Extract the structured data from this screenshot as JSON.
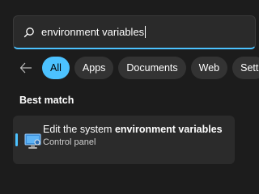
{
  "search": {
    "query": "environment variables",
    "icon": "search-icon"
  },
  "filters": {
    "back_icon": "arrow-left-icon",
    "chips": [
      {
        "label": "All",
        "active": true
      },
      {
        "label": "Apps",
        "active": false
      },
      {
        "label": "Documents",
        "active": false
      },
      {
        "label": "Web",
        "active": false
      },
      {
        "label": "Sett",
        "active": false
      }
    ]
  },
  "best_match": {
    "title": "Best match",
    "result": {
      "title_prefix": "Edit the system ",
      "title_bold": "environment variables",
      "subtitle": "Control panel",
      "icon": "monitor-settings-icon"
    }
  },
  "colors": {
    "accent": "#4cc2ff",
    "background": "#1c1c1c",
    "surface": "#2b2b2b"
  }
}
